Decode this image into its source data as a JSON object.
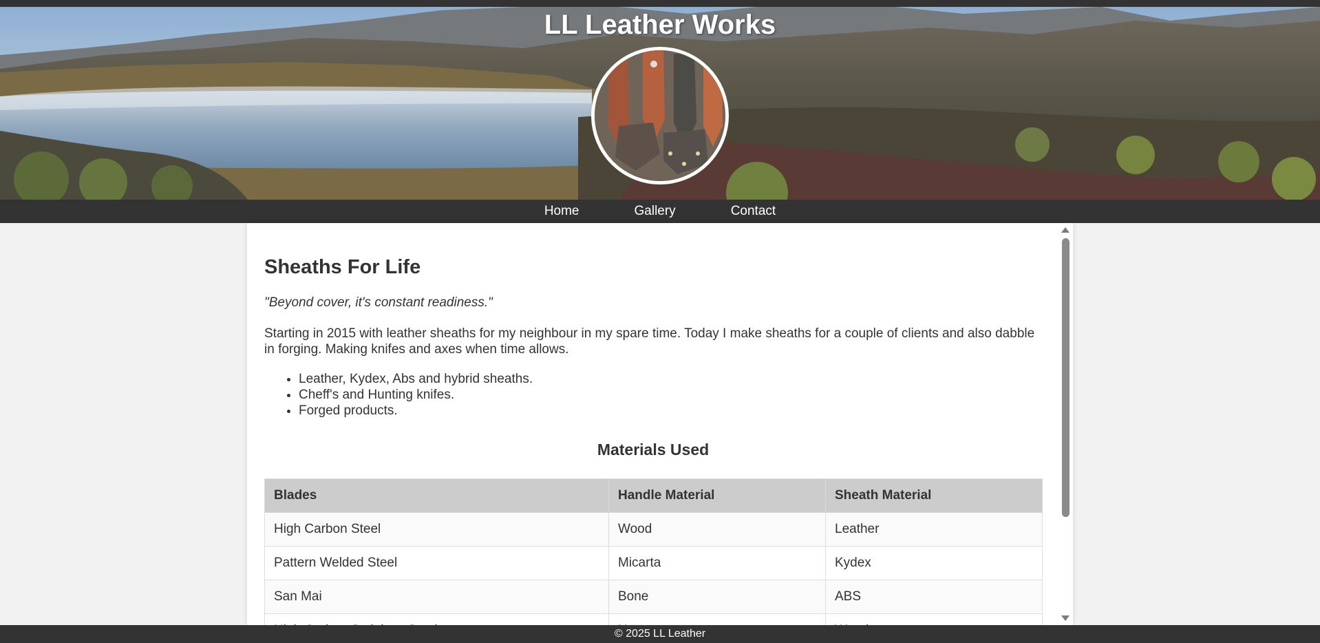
{
  "header": {
    "title": "LL Leather Works"
  },
  "nav": {
    "items": [
      {
        "label": "Home"
      },
      {
        "label": "Gallery"
      },
      {
        "label": "Contact"
      }
    ]
  },
  "main": {
    "heading": "Sheaths For Life",
    "tagline": "\"Beyond cover, it's constant readiness.\"",
    "intro": "Starting in 2015 with leather sheaths for my neighbour in my spare time. Today I make sheaths for a couple of clients and also dabble in forging. Making knifes and axes when time allows.",
    "features": [
      "Leather, Kydex, Abs and hybrid sheaths.",
      "Cheff's and Hunting knifes.",
      "Forged products."
    ],
    "table_heading": "Materials Used",
    "table": {
      "headers": [
        "Blades",
        "Handle Material",
        "Sheath Material"
      ],
      "rows": [
        [
          "High Carbon Steel",
          "Wood",
          "Leather"
        ],
        [
          "Pattern Welded Steel",
          "Micarta",
          "Kydex"
        ],
        [
          "San Mai",
          "Bone",
          "ABS"
        ],
        [
          "High Carbon Stainless Steel",
          "Horn",
          "Wood"
        ]
      ]
    }
  },
  "footer": {
    "text": "© 2025 LL Leather"
  },
  "colors": {
    "bars": "#333333",
    "page_background": "#f2f2f2",
    "table_header": "#cccccc"
  }
}
